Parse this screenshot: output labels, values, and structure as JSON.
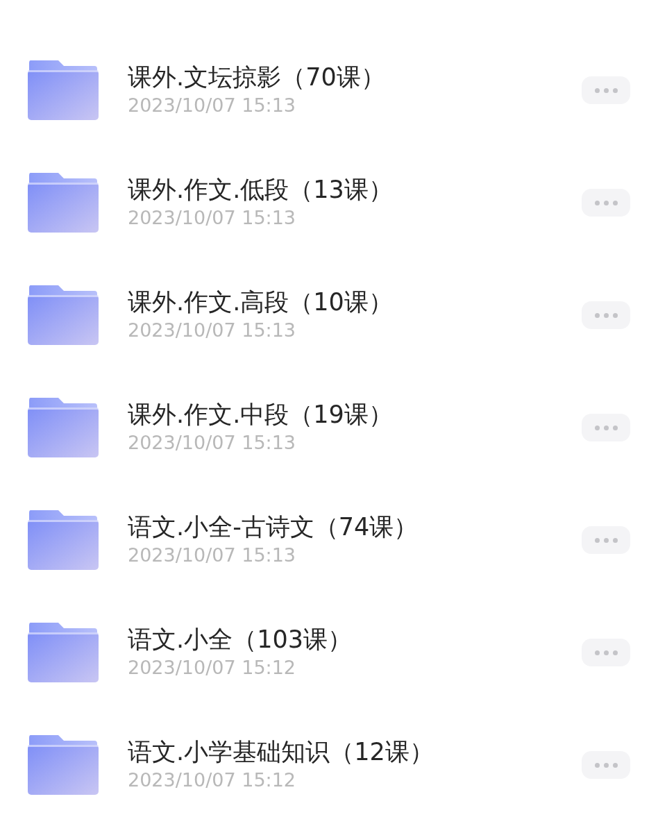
{
  "folders": [
    {
      "title": "课外.文坛掠影（70课）",
      "date": "2023/10/07 15:13"
    },
    {
      "title": "课外.作文.低段（13课）",
      "date": "2023/10/07 15:13"
    },
    {
      "title": "课外.作文.高段（10课）",
      "date": "2023/10/07 15:13"
    },
    {
      "title": "课外.作文.中段（19课）",
      "date": "2023/10/07 15:13"
    },
    {
      "title": "语文.小全-古诗文（74课）",
      "date": "2023/10/07 15:13"
    },
    {
      "title": "语文.小全（103课）",
      "date": "2023/10/07 15:12"
    },
    {
      "title": "语文.小学基础知识（12课）",
      "date": "2023/10/07 15:12"
    }
  ]
}
